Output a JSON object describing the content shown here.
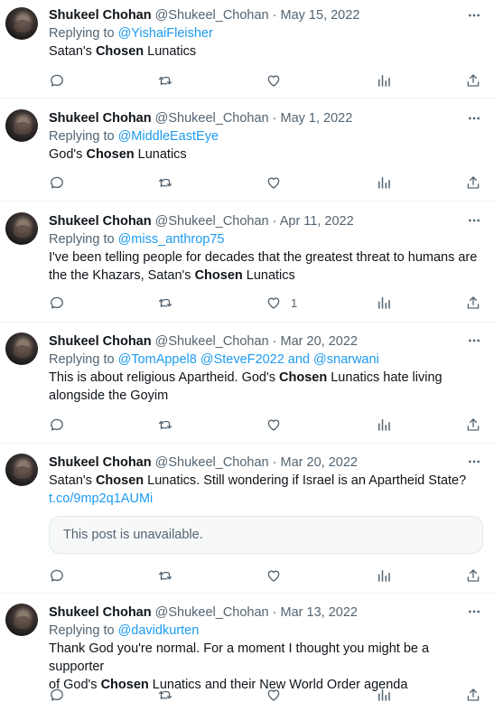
{
  "tweets": [
    {
      "name": "Shukeel Chohan",
      "handle": "@Shukeel_Chohan",
      "date": "May 15, 2022",
      "replying_prefix": "Replying to ",
      "replying_to": "@YishaiFleisher",
      "text_before": "Satan's ",
      "text_bold": "Chosen",
      "text_after": " Lunatics",
      "likes": ""
    },
    {
      "name": "Shukeel Chohan",
      "handle": "@Shukeel_Chohan",
      "date": "May 1, 2022",
      "replying_prefix": "Replying to ",
      "replying_to": "@MiddleEastEye",
      "text_before": "God's ",
      "text_bold": "Chosen",
      "text_after": " Lunatics",
      "likes": ""
    },
    {
      "name": "Shukeel Chohan",
      "handle": "@Shukeel_Chohan",
      "date": "Apr 11, 2022",
      "replying_prefix": "Replying to ",
      "replying_to": "@miss_anthrop75",
      "text_line1": "I've been telling people for decades that the greatest threat to humans are",
      "text_before": "the the Khazars, Satan's ",
      "text_bold": "Chosen",
      "text_after": " Lunatics",
      "likes": "1"
    },
    {
      "name": "Shukeel Chohan",
      "handle": "@Shukeel_Chohan",
      "date": "Mar 20, 2022",
      "replying_prefix": "Replying to ",
      "replying_to": "@TomAppel8 @SteveF2022 and @snarwani",
      "text_before": "This is about religious Apartheid. God's ",
      "text_bold": "Chosen",
      "text_after": " Lunatics hate living",
      "text_line2": "alongside the Goyim",
      "likes": ""
    },
    {
      "name": "Shukeel Chohan",
      "handle": "@Shukeel_Chohan",
      "date": "Mar 20, 2022",
      "text_before": "Satan's ",
      "text_bold": "Chosen",
      "text_after": " Lunatics. Still wondering if Israel is an Apartheid State?",
      "link": "t.co/9mp2q1AUMi",
      "unavailable": "This post is unavailable.",
      "likes": ""
    },
    {
      "name": "Shukeel Chohan",
      "handle": "@Shukeel_Chohan",
      "date": "Mar 13, 2022",
      "replying_prefix": "Replying to ",
      "replying_to": "@davidkurten",
      "text_line1": "Thank God you're normal. For a moment I thought you might be a supporter",
      "text_before": "of God's ",
      "text_bold": "Chosen",
      "text_after": " Lunatics and their New World Order agenda",
      "likes": ""
    }
  ],
  "separator": " · ",
  "icons": [
    "reply-icon",
    "retweet-icon",
    "like-icon",
    "views-icon",
    "share-icon",
    "more-icon"
  ],
  "colors": {
    "link": "#1d9bf0",
    "muted": "#536471",
    "text": "#0f1419"
  }
}
